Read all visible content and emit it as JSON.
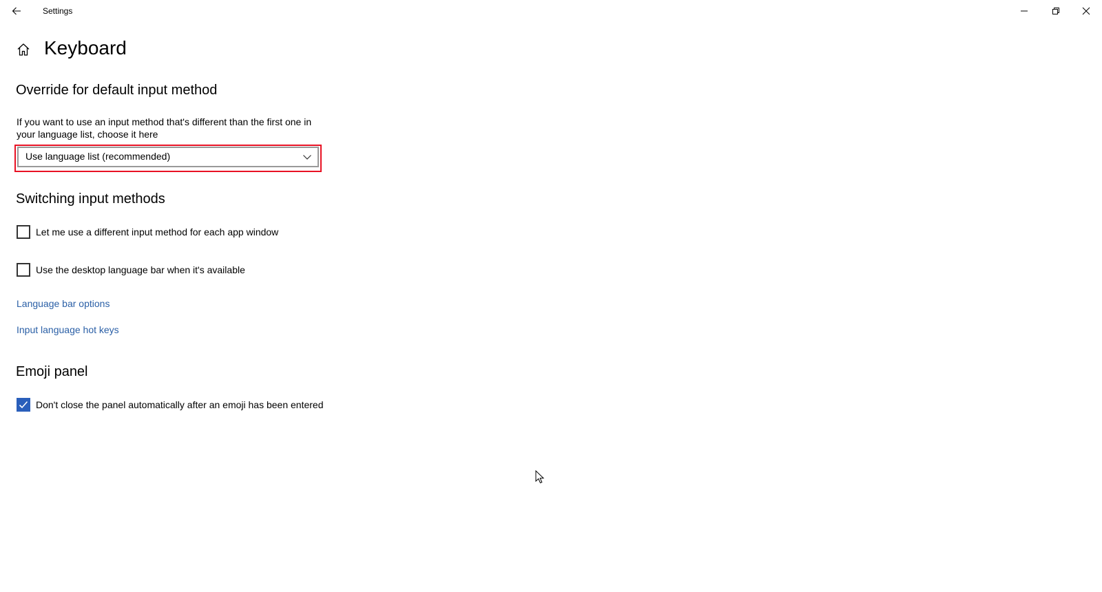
{
  "window": {
    "title": "Settings",
    "back_icon": "arrow-left-icon",
    "minimize_icon": "minimize-icon",
    "maximize_icon": "restore-icon",
    "close_icon": "close-icon"
  },
  "page": {
    "home_icon": "home-icon",
    "title": "Keyboard"
  },
  "override": {
    "heading": "Override for default input method",
    "description": "If you want to use an input method that's different than the first one in your language list, choose it here",
    "dropdown_value": "Use language list (recommended)",
    "highlight_color": "#e81123"
  },
  "switching": {
    "heading": "Switching input methods",
    "checkboxes": [
      {
        "label": "Let me use a different input method for each app window",
        "checked": false
      },
      {
        "label": "Use the desktop language bar when it's available",
        "checked": false
      }
    ],
    "links": [
      "Language bar options",
      "Input language hot keys"
    ]
  },
  "emoji": {
    "heading": "Emoji panel",
    "checkbox": {
      "label": "Don't close the panel automatically after an emoji has been entered",
      "checked": true
    }
  },
  "colors": {
    "accent": "#2a5fbb",
    "link": "#2a5fa6"
  }
}
